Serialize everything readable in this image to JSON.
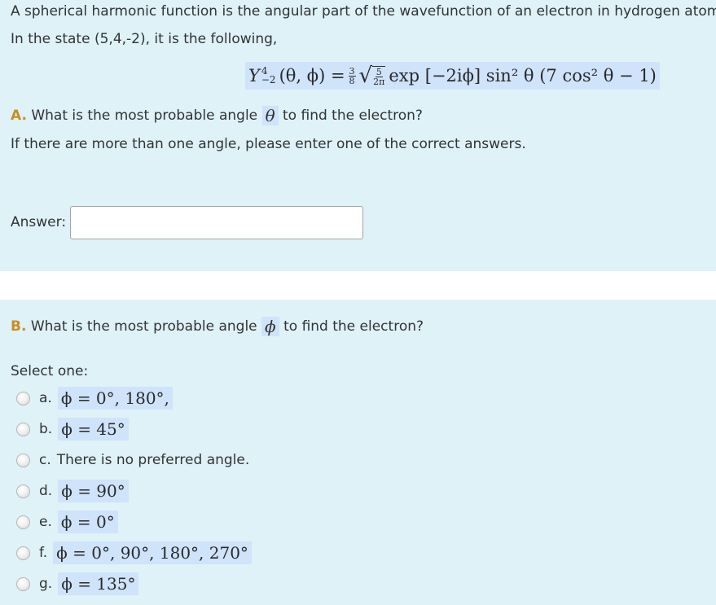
{
  "part_a": {
    "intro_line1": "A spherical harmonic function is the angular part of the wavefunction of an electron in hydrogen atom.",
    "intro_line2": "In the state (5,4,-2), it is the following,",
    "equation": {
      "lhs": "Y",
      "lhs_sup": "4",
      "lhs_sub": "−2",
      "args": "(θ, ϕ) =",
      "frac1_num": "3",
      "frac1_den": "8",
      "frac2_num": "5",
      "frac2_den": "2π",
      "rest": "exp [−2iϕ] sin² θ (7 cos² θ − 1)"
    },
    "letter": "A.",
    "question_before": "What is the most probable angle",
    "question_symbol": "θ",
    "question_after": "to find the electron?",
    "note": "If there are more than one angle, please enter one of the correct answers.",
    "answer_label": "Answer:",
    "answer_value": ""
  },
  "part_b": {
    "letter": "B.",
    "question_before": "What is the most probable angle",
    "question_symbol": "ϕ",
    "question_after": "to find the electron?",
    "select_label": "Select one:",
    "options": [
      {
        "letter": "a.",
        "math": "ϕ = 0°, 180°,",
        "is_math": true
      },
      {
        "letter": "b.",
        "math": "ϕ = 45°",
        "is_math": true
      },
      {
        "letter": "c.",
        "math": "There is no preferred angle.",
        "is_math": false
      },
      {
        "letter": "d.",
        "math": "ϕ = 90°",
        "is_math": true
      },
      {
        "letter": "e.",
        "math": "ϕ = 0°",
        "is_math": true
      },
      {
        "letter": "f.",
        "math": "ϕ = 0°, 90°, 180°, 270°",
        "is_math": true
      },
      {
        "letter": "g.",
        "math": "ϕ = 135°",
        "is_math": true
      }
    ]
  },
  "colors": {
    "panel_bg": "#def2f8",
    "math_highlight": "#cfe3fb",
    "label_letter": "#cc8d22"
  }
}
